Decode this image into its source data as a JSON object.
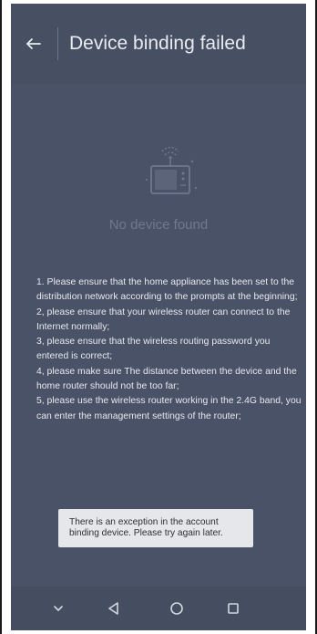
{
  "header": {
    "back_icon": "back-arrow-icon",
    "title": "Device binding failed"
  },
  "empty_state": {
    "illustration_icon": "router-device-icon",
    "message": "No device found"
  },
  "instructions": [
    "1. Please ensure that the home appliance has been set to the distribution network according to the prompts at the beginning;",
    "2, please ensure that your wireless router can connect to the Internet normally;",
    "3, please ensure that the wireless routing password you entered is correct;",
    "4, please make sure The distance between the device and the home router should not be too far;",
    "5, please use the wireless router working in the 2.4G band, you can enter the management settings of the router;"
  ],
  "toast": {
    "message": "There is an exception in the account binding device. Please try again later."
  },
  "navbar": {
    "icons": [
      "chevron-down-icon",
      "back-triangle-icon",
      "home-circle-icon",
      "recents-square-icon"
    ]
  },
  "colors": {
    "background": "#4a5267",
    "header": "#474f63",
    "text_primary": "#e9ebf0",
    "text_muted": "#6f7891",
    "toast_bg": "#e5e7eb"
  }
}
